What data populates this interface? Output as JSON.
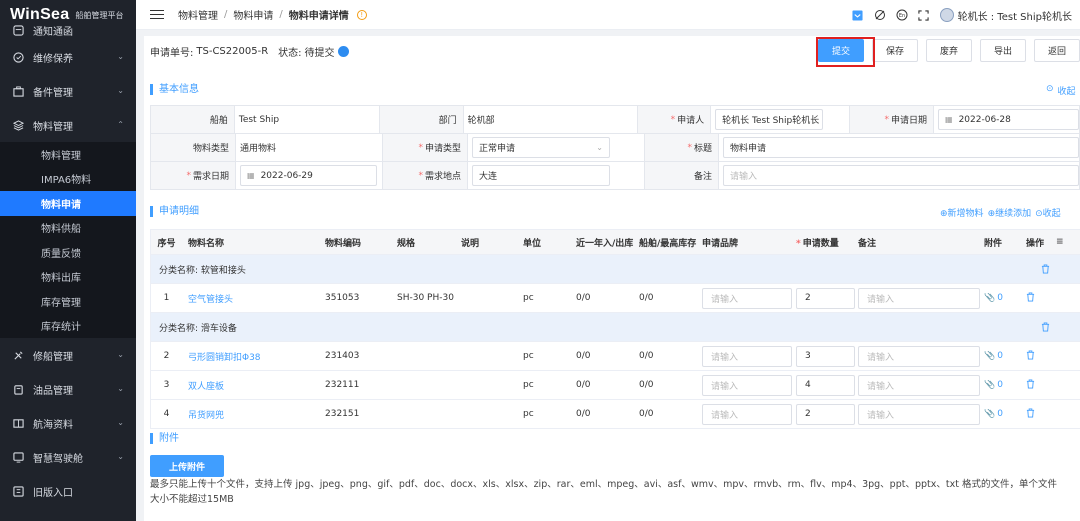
{
  "brand": {
    "logo": "WinSea",
    "subtitle": "船舶管理平台"
  },
  "sidebar": {
    "items": [
      {
        "label": "通知通函",
        "icon": "notice-icon"
      },
      {
        "label": "维修保养",
        "icon": "maintenance-icon",
        "chevron": "down"
      },
      {
        "label": "备件管理",
        "icon": "spare-parts-icon",
        "chevron": "down"
      },
      {
        "label": "物料管理",
        "icon": "material-icon",
        "chevron": "up"
      }
    ],
    "sub_items": [
      "物料管理",
      "IMPA6物料",
      "物料申请",
      "物料供船",
      "质量反馈",
      "物料出库",
      "库存管理",
      "库存统计"
    ],
    "items_after": [
      {
        "label": "修船管理",
        "icon": "repair-icon",
        "chevron": "down"
      },
      {
        "label": "油品管理",
        "icon": "oil-icon",
        "chevron": "down"
      },
      {
        "label": "航海资料",
        "icon": "nautical-icon",
        "chevron": "down"
      },
      {
        "label": "智慧驾驶舱",
        "icon": "dashboard-icon",
        "chevron": "down"
      },
      {
        "label": "旧版入口",
        "icon": "old-entry-icon"
      }
    ]
  },
  "header": {
    "breadcrumb": [
      "物料管理",
      "物料申请",
      "物料申请详情"
    ],
    "separator": "/",
    "user": "轮机长 : Test Ship轮机长"
  },
  "topbar": {
    "no_label": "申请单号:",
    "no_value": "TS-CS22005-R",
    "state_label": "状态:",
    "state_value": "待提交",
    "buttons": {
      "submit": "提交",
      "save": "保存",
      "discard": "废弃",
      "export": "导出",
      "back": "返回"
    }
  },
  "basic": {
    "title": "基本信息",
    "collapse": "收起",
    "ship_label": "船舶",
    "ship_value": "Test Ship",
    "dept_label": "部门",
    "dept_value": "轮机部",
    "applicant_label": "申请人",
    "applicant_value": "轮机长  Test Ship轮机长",
    "apply_date_label": "申请日期",
    "apply_date_value": "2022-06-28",
    "mtype_label": "物料类型",
    "mtype_value": "通用物料",
    "atype_label": "申请类型",
    "atype_value": "正常申请",
    "subject_label": "标题",
    "subject_value": "物料申请",
    "need_date_label": "需求日期",
    "need_date_value": "2022-06-29",
    "place_label": "需求地点",
    "place_value": "大连",
    "remark_label": "备注",
    "remark_placeholder": "请输入"
  },
  "detail": {
    "title": "申请明细",
    "add": "新增物料",
    "continue_add": "继续添加",
    "collapse": "收起",
    "columns": [
      "序号",
      "物料名称",
      "物料编码",
      "规格",
      "说明",
      "单位",
      "近一年入/出库",
      "船舶/最高库存",
      "申请品牌",
      "申请数量",
      "备注",
      "附件",
      "操作"
    ],
    "placeholder": "请输入",
    "groups": [
      {
        "label": "分类名称:  软管和接头",
        "rows": [
          {
            "no": "1",
            "name": "空气管接头",
            "code": "351053",
            "spec": "SH-30 PH-30",
            "desc": "",
            "unit": "pc",
            "year": "0/0",
            "stock": "0/0",
            "qty": "2",
            "att": "0"
          }
        ]
      },
      {
        "label": "分类名称:  滑车设备",
        "rows": [
          {
            "no": "2",
            "name": "弓形圆销卸扣Φ38",
            "code": "231403",
            "spec": "",
            "desc": "",
            "unit": "pc",
            "year": "0/0",
            "stock": "0/0",
            "qty": "3",
            "att": "0"
          },
          {
            "no": "3",
            "name": "双人座板",
            "code": "232111",
            "spec": "",
            "desc": "",
            "unit": "pc",
            "year": "0/0",
            "stock": "0/0",
            "qty": "4",
            "att": "0"
          },
          {
            "no": "4",
            "name": "吊货网兜",
            "code": "232151",
            "spec": "",
            "desc": "",
            "unit": "pc",
            "year": "0/0",
            "stock": "0/0",
            "qty": "2",
            "att": "0"
          }
        ]
      }
    ]
  },
  "attachments": {
    "title": "附件",
    "upload": "上传附件",
    "tip": "最多只能上传十个文件，支持上传 jpg、jpeg、png、gif、pdf、doc、docx、xls、xlsx、zip、rar、eml、mpeg、avi、asf、wmv、mpv、rmvb、rm、flv、mp4、3pg、ppt、pptx、txt 格式的文件，单个文件大小不能超过15MB"
  },
  "colors": {
    "accent": "#409eff",
    "sidebar_bg": "#1f232b",
    "active": "#1f7aff",
    "required": "#f56c6c",
    "highlight": "#e02020"
  }
}
